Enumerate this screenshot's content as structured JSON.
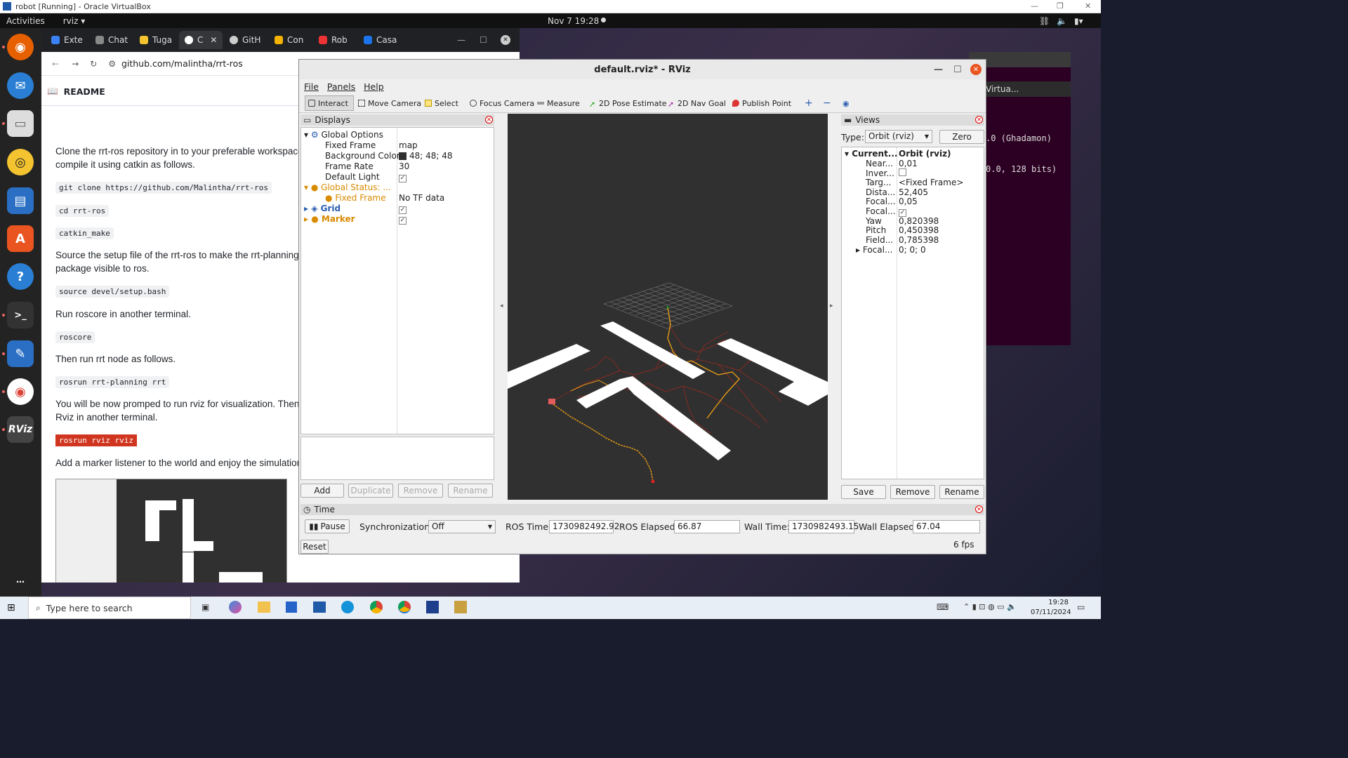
{
  "vbox": {
    "title": "robot [Running] - Oracle VirtualBox"
  },
  "gnome": {
    "activities": "Activities",
    "app": "rviz ▾",
    "clock": "Nov 7  19:28"
  },
  "chrome": {
    "tabs": [
      {
        "label": "Exte",
        "color": "#3b82f6"
      },
      {
        "label": "Chat",
        "color": "#888"
      },
      {
        "label": "Tuga",
        "color": "#f4c430"
      },
      {
        "label": "C",
        "color": "#fff"
      },
      {
        "label": "GitH",
        "color": "#ccc"
      },
      {
        "label": "Con",
        "color": "#f4b400"
      },
      {
        "label": "Rob",
        "color": "#e33"
      },
      {
        "label": "Casa",
        "color": "#1a73e8"
      }
    ],
    "url": "github.com/malintha/rrt-ros",
    "readme": "README",
    "content": {
      "p1": "Clone the rrt-ros repository in to your preferable workspace,",
      "p1b": "compile it using catkin as follows.",
      "c1": "git clone https://github.com/Malintha/rrt-ros",
      "c2": "cd rrt-ros",
      "c3": "catkin_make",
      "p2": "Source the setup file of the rrt-ros to make the rrt-planning",
      "p2b": "package visible to ros.",
      "c4": "source devel/setup.bash",
      "p3": "Run roscore in another terminal.",
      "c5": "roscore",
      "p4": "Then run rrt node as follows.",
      "c6": "rosrun rrt-planning rrt",
      "p5": "You will be now promped to run rviz for visualization. Then r",
      "p5b": "Rviz in another terminal.",
      "c7": "rosrun rviz rviz",
      "p6": "Add a marker listener to the world and enjoy the simulation!"
    }
  },
  "terminal": {
    "line1": ".0 (Ghadamon)",
    "line2": "0.0, 128 bits)",
    "tab": "Virtua..."
  },
  "rviz": {
    "title": "default.rviz* - RViz",
    "menu": [
      "File",
      "Panels",
      "Help"
    ],
    "tools": [
      "Interact",
      "Move Camera",
      "Select",
      "Focus Camera",
      "Measure",
      "2D Pose Estimate",
      "2D Nav Goal",
      "Publish Point"
    ],
    "displays": {
      "header": "Displays",
      "rows": [
        {
          "name": "Global Options",
          "value": ""
        },
        {
          "name": "Fixed Frame",
          "value": "map"
        },
        {
          "name": "Background Color",
          "value": "48; 48; 48"
        },
        {
          "name": "Frame Rate",
          "value": "30"
        },
        {
          "name": "Default Light",
          "value": "✓"
        },
        {
          "name": "Global Status: ...",
          "value": ""
        },
        {
          "name": "Fixed Frame",
          "value": "No TF data"
        },
        {
          "name": "Grid",
          "value": "✓"
        },
        {
          "name": "Marker",
          "value": "✓"
        }
      ],
      "buttons": [
        "Add",
        "Duplicate",
        "Remove",
        "Rename"
      ]
    },
    "views": {
      "header": "Views",
      "type_label": "Type:",
      "type_value": "Orbit (rviz)",
      "zero": "Zero",
      "rows": [
        {
          "name": "Current...",
          "value": "Orbit (rviz)"
        },
        {
          "name": "Near...",
          "value": "0,01"
        },
        {
          "name": "Inver...",
          "value": ""
        },
        {
          "name": "Targ...",
          "value": "<Fixed Frame>"
        },
        {
          "name": "Dista...",
          "value": "52,405"
        },
        {
          "name": "Focal...",
          "value": "0,05"
        },
        {
          "name": "Focal...",
          "value": "✓"
        },
        {
          "name": "Yaw",
          "value": "0,820398"
        },
        {
          "name": "Pitch",
          "value": "0,450398"
        },
        {
          "name": "Field...",
          "value": "0,785398"
        },
        {
          "name": "Focal...",
          "value": "0; 0; 0"
        }
      ],
      "buttons": [
        "Save",
        "Remove",
        "Rename"
      ]
    },
    "time": {
      "header": "Time",
      "pause": "Pause",
      "sync_label": "Synchronization:",
      "sync_value": "Off",
      "ros_time_label": "ROS Time:",
      "ros_time": "1730982492.92",
      "ros_elapsed_label": "ROS Elapsed:",
      "ros_elapsed": "66.87",
      "wall_time_label": "Wall Time:",
      "wall_time": "1730982493.15",
      "wall_elapsed_label": "Wall Elapsed:",
      "wall_elapsed": "67.04",
      "reset": "Reset",
      "fps": "6 fps"
    }
  },
  "taskbar": {
    "search_placeholder": "Type here to search",
    "time": "19:28",
    "date": "07/11/2024"
  },
  "colors": {
    "accent": "#1a73e8",
    "rviz_orange": "#d88a00",
    "rviz_blue": "#2a5db0",
    "code_red": "#d0351f"
  }
}
